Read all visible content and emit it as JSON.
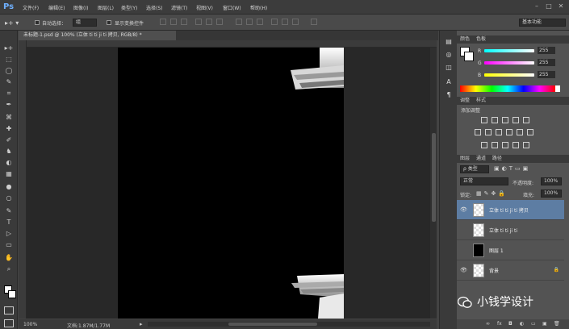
{
  "app": {
    "logo": "Ps"
  },
  "menu": [
    "文件(F)",
    "编辑(E)",
    "图像(I)",
    "图层(L)",
    "类型(Y)",
    "选择(S)",
    "滤镜(T)",
    "视图(V)",
    "窗口(W)",
    "帮助(H)"
  ],
  "window_controls": [
    "–",
    "□",
    "✕"
  ],
  "options": {
    "auto_select_label": "自动选择：",
    "auto_select_value": "组",
    "show_transform_label": "显示变换控件",
    "workspace": "基本功能"
  },
  "document": {
    "tab_title": "未标题-1.psd @ 100% (立体 ti  ti  ji  ti 拷贝, RGB/8) *",
    "zoom": "100%",
    "doc_size": "文档:1.87M/1.77M"
  },
  "tools": [
    "▸+",
    "⬚",
    "◯",
    "✎",
    "⌗",
    "✒",
    "⌘",
    "✚",
    "✐",
    "♞",
    "◐",
    "▦",
    "●",
    "○",
    "✎",
    "T",
    "▷",
    "▭",
    "✋",
    "⌕"
  ],
  "side_icons": [
    "▤",
    "◎",
    "◫",
    "A",
    "¶"
  ],
  "color_panel": {
    "tabs": [
      "颜色",
      "色板"
    ],
    "channels": [
      {
        "label": "R",
        "value": "255"
      },
      {
        "label": "G",
        "value": "255"
      },
      {
        "label": "B",
        "value": "255"
      }
    ]
  },
  "adjust_panel": {
    "tabs": [
      "调整",
      "样式"
    ],
    "heading": "添加调整"
  },
  "layers_panel": {
    "tabs": [
      "图层",
      "通道",
      "路径"
    ],
    "filter": "ρ 类型",
    "blend_mode": "正常",
    "opacity_label": "不透明度:",
    "opacity_value": "100%",
    "lock_label": "锁定:",
    "fill_label": "填充:",
    "fill_value": "100%",
    "layers": [
      {
        "name": "立体 ti  ti  ji  ti 拷贝",
        "visible": true,
        "selected": true
      },
      {
        "name": "立体 ti  ti  ji  ti",
        "visible": false,
        "selected": false
      },
      {
        "name": "图层 1",
        "visible": false,
        "selected": false
      },
      {
        "name": "背景",
        "visible": true,
        "selected": false,
        "locked": true
      }
    ],
    "footer_icons": [
      "∞",
      "fx",
      "◘",
      "◐",
      "▭",
      "▣",
      "🗑"
    ]
  },
  "watermark": "小钱学设计",
  "colors": {
    "accent": "#5d7da3",
    "bg": "#535353"
  }
}
